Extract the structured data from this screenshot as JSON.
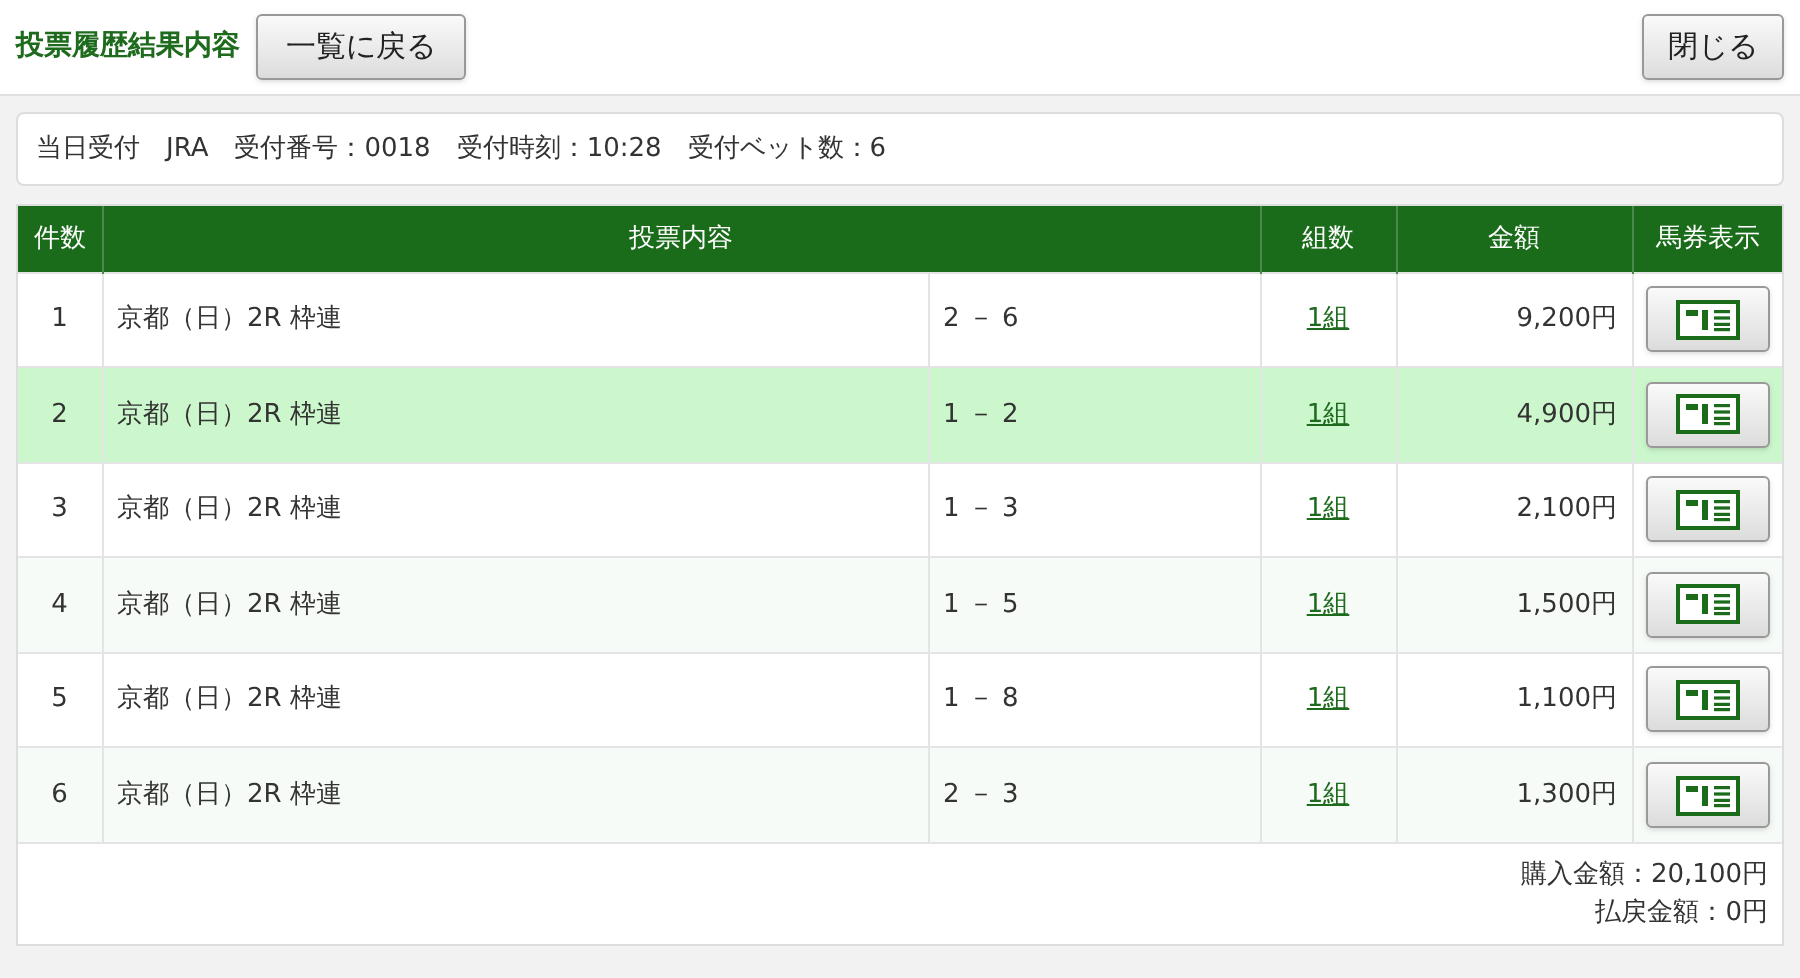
{
  "header": {
    "title": "投票履歴結果内容",
    "back_button": "一覧に戻る",
    "close_button": "閉じる"
  },
  "info": [
    "当日受付",
    "JRA",
    "受付番号：0018",
    "受付時刻：10:28",
    "受付ベット数：6"
  ],
  "table": {
    "columns": [
      "件数",
      "投票内容",
      "組数",
      "金額",
      "馬券表示"
    ],
    "rows": [
      {
        "no": "1",
        "race": "京都（日）2R 枠連",
        "numbers": "2 － 6",
        "count": "1組",
        "amount": "9,200円",
        "selected": false
      },
      {
        "no": "2",
        "race": "京都（日）2R 枠連",
        "numbers": "1 － 2",
        "count": "1組",
        "amount": "4,900円",
        "selected": true
      },
      {
        "no": "3",
        "race": "京都（日）2R 枠連",
        "numbers": "1 － 3",
        "count": "1組",
        "amount": "2,100円",
        "selected": false
      },
      {
        "no": "4",
        "race": "京都（日）2R 枠連",
        "numbers": "1 － 5",
        "count": "1組",
        "amount": "1,500円",
        "selected": false
      },
      {
        "no": "5",
        "race": "京都（日）2R 枠連",
        "numbers": "1 － 8",
        "count": "1組",
        "amount": "1,100円",
        "selected": false
      },
      {
        "no": "6",
        "race": "京都（日）2R 枠連",
        "numbers": "2 － 3",
        "count": "1組",
        "amount": "1,300円",
        "selected": false
      }
    ]
  },
  "totals": [
    "購入金額：20,100円",
    "払戻金額：0円"
  ]
}
